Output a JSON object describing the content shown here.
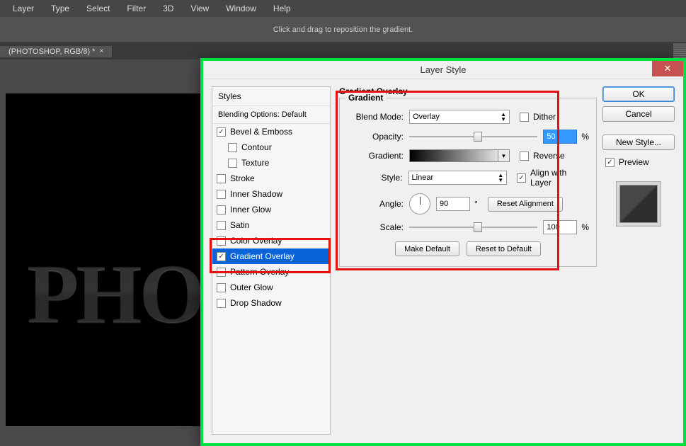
{
  "menus": [
    "Layer",
    "Type",
    "Select",
    "Filter",
    "3D",
    "View",
    "Window",
    "Help"
  ],
  "infobar": "Click and drag to reposition the gradient.",
  "document_tab": "(PHOTOSHOP, RGB/8) *",
  "canvas_text": "PHO",
  "dialog": {
    "title": "Layer Style",
    "styles_header": "Styles",
    "blending_header": "Blending Options: Default",
    "effects": [
      {
        "label": "Bevel & Emboss",
        "checked": true
      },
      {
        "label": "Contour",
        "checked": false,
        "indent": true
      },
      {
        "label": "Texture",
        "checked": false,
        "indent": true
      },
      {
        "label": "Stroke",
        "checked": false
      },
      {
        "label": "Inner Shadow",
        "checked": false
      },
      {
        "label": "Inner Glow",
        "checked": false
      },
      {
        "label": "Satin",
        "checked": false
      },
      {
        "label": "Color Overlay",
        "checked": false
      },
      {
        "label": "Gradient Overlay",
        "checked": true,
        "selected": true
      },
      {
        "label": "Pattern Overlay",
        "checked": false
      },
      {
        "label": "Outer Glow",
        "checked": false
      },
      {
        "label": "Drop Shadow",
        "checked": false
      }
    ],
    "panel_title": "Gradient Overlay",
    "group_title": "Gradient",
    "blend_mode_label": "Blend Mode:",
    "blend_mode_value": "Overlay",
    "dither_label": "Dither",
    "opacity_label": "Opacity:",
    "opacity_value": "50",
    "pct": "%",
    "gradient_label": "Gradient:",
    "reverse_label": "Reverse",
    "style_label": "Style:",
    "style_value": "Linear",
    "align_label": "Align with Layer",
    "angle_label": "Angle:",
    "angle_value": "90",
    "deg": "°",
    "reset_align": "Reset Alignment",
    "scale_label": "Scale:",
    "scale_value": "100",
    "make_default": "Make Default",
    "reset_default": "Reset to Default",
    "ok": "OK",
    "cancel": "Cancel",
    "new_style": "New Style...",
    "preview_label": "Preview"
  }
}
